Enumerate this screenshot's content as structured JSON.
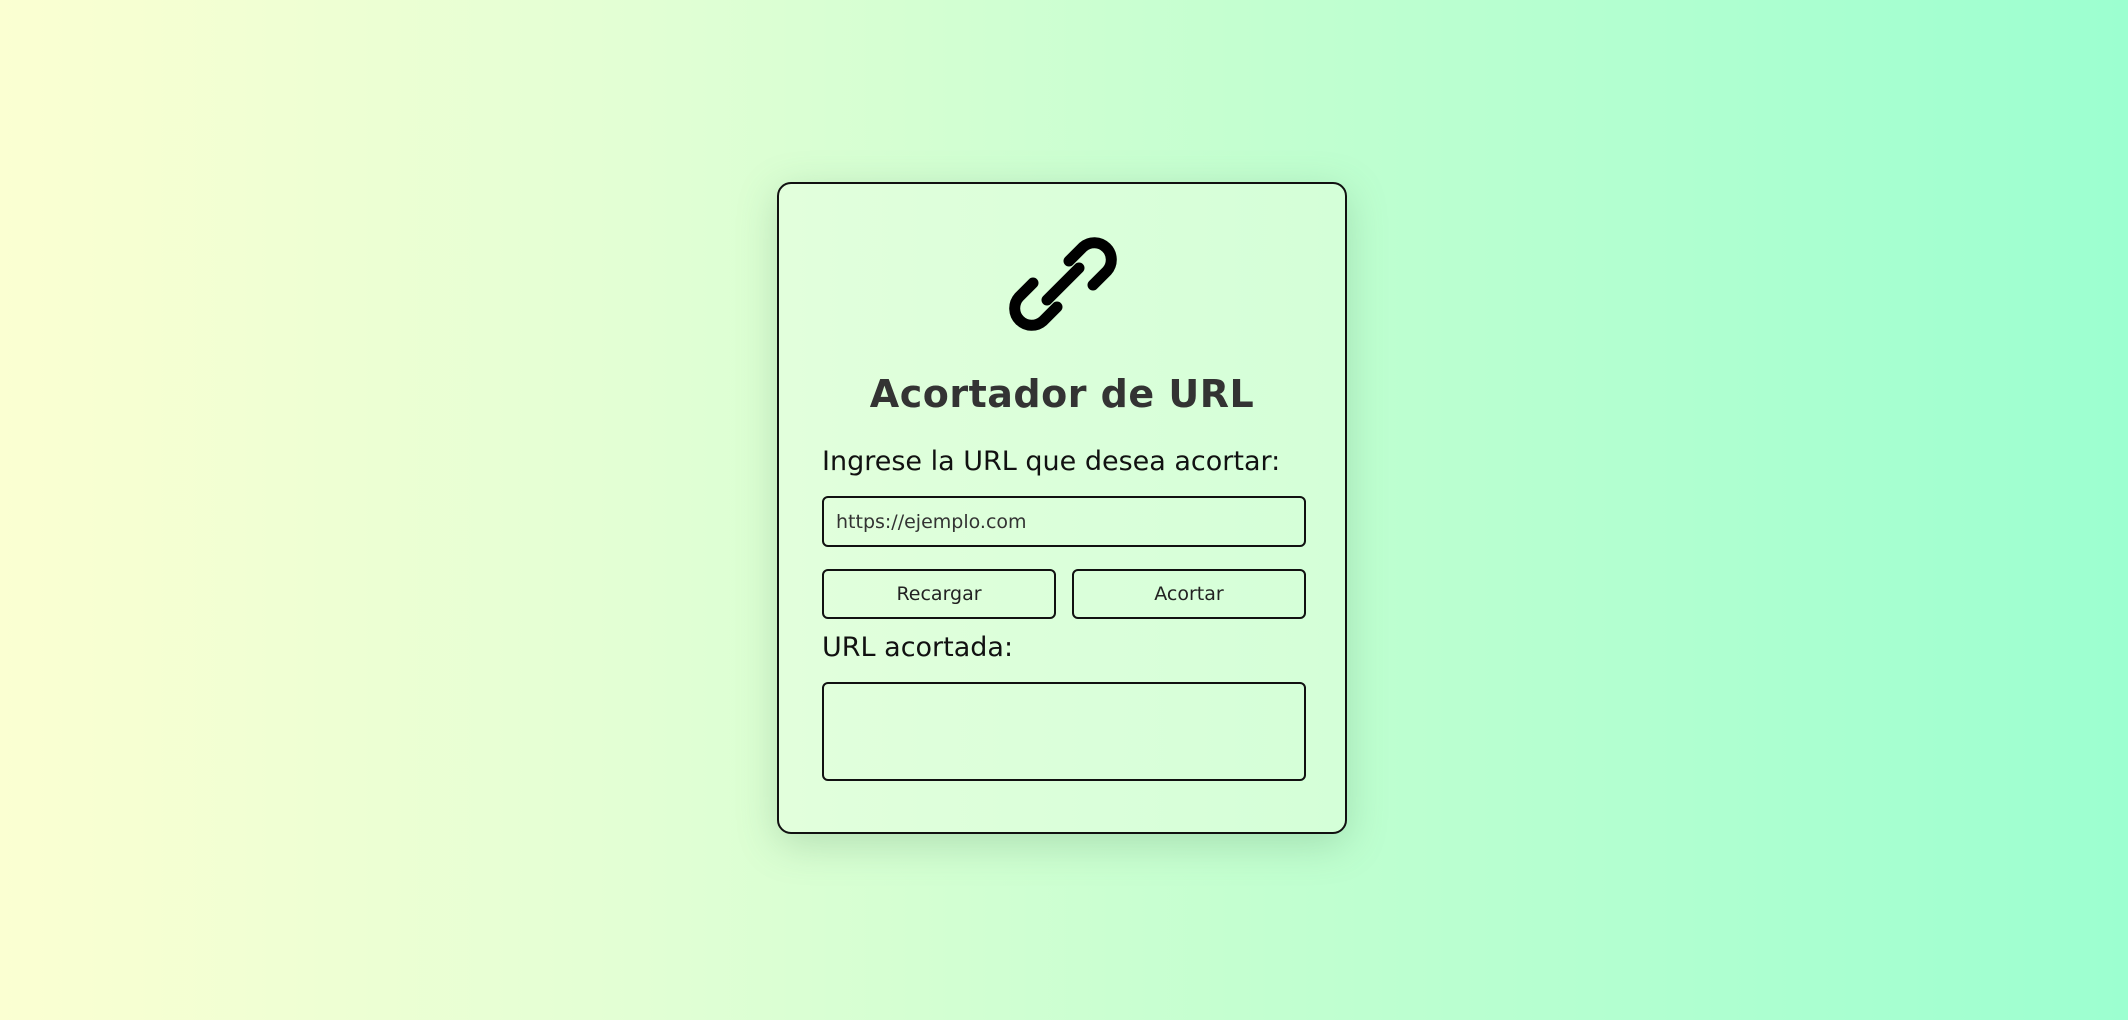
{
  "page": {
    "background_colors": [
      "#fbffd2",
      "#9cffd0"
    ],
    "border_color": "#111111"
  },
  "card": {
    "icon": "link-icon",
    "title": "Acortador de URL",
    "input_label": "Ingrese la URL que desea acortar:",
    "url_input": {
      "value": "",
      "placeholder": "https://ejemplo.com"
    },
    "buttons": {
      "reload_label": "Recargar",
      "shorten_label": "Acortar"
    },
    "result_label": "URL acortada:",
    "result_value": ""
  }
}
